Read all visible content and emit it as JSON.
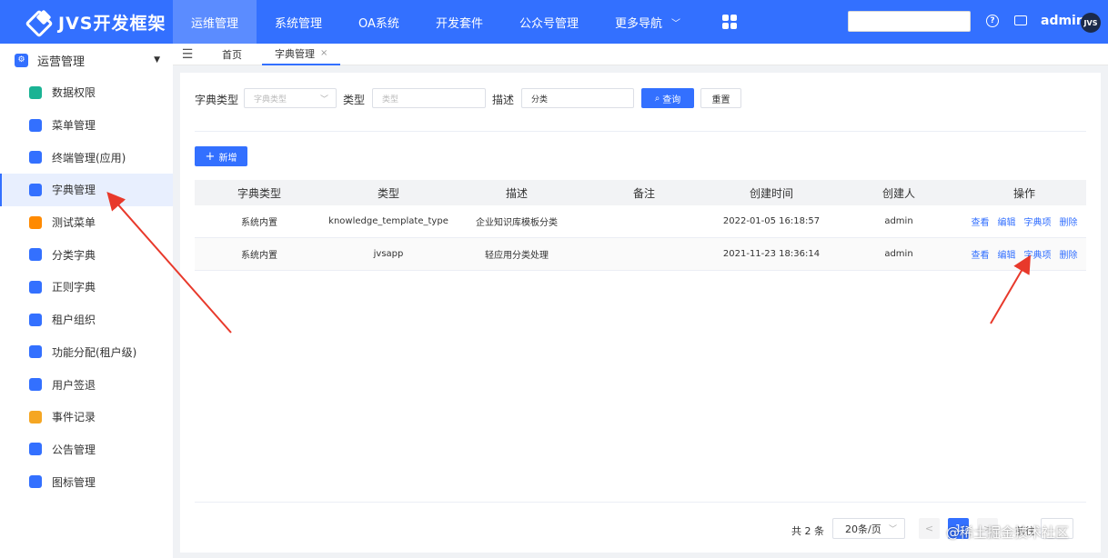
{
  "app": {
    "logo_text": "JVS开发框架"
  },
  "topnav": {
    "items": [
      {
        "label": "运维管理",
        "active": true
      },
      {
        "label": "系统管理",
        "active": false
      },
      {
        "label": "OA系统",
        "active": false
      },
      {
        "label": "开发套件",
        "active": false
      },
      {
        "label": "公众号管理",
        "active": false
      },
      {
        "label": "更多导航",
        "active": false
      }
    ],
    "user_name": "admin",
    "avatar_text": "JVS"
  },
  "sidebar": {
    "group_label": "运营管理",
    "items": [
      {
        "label": "数据权限",
        "icon": "data-permission-icon",
        "color": "#1ab394"
      },
      {
        "label": "菜单管理",
        "icon": "menu-icon",
        "color": "#3370ff"
      },
      {
        "label": "终端管理(应用)",
        "icon": "terminal-icon",
        "color": "#3370ff"
      },
      {
        "label": "字典管理",
        "icon": "dictionary-icon",
        "color": "#3370ff",
        "active": true
      },
      {
        "label": "测试菜单",
        "icon": "home-icon",
        "color": "#ff8a00"
      },
      {
        "label": "分类字典",
        "icon": "chart-icon",
        "color": "#3370ff"
      },
      {
        "label": "正则字典",
        "icon": "regex-icon",
        "color": "#3370ff"
      },
      {
        "label": "租户组织",
        "icon": "tenant-icon",
        "color": "#3370ff"
      },
      {
        "label": "功能分配(租户级)",
        "icon": "function-icon",
        "color": "#3370ff"
      },
      {
        "label": "用户签退",
        "icon": "logout-icon",
        "color": "#3370ff"
      },
      {
        "label": "事件记录",
        "icon": "event-icon",
        "color": "#f5a623"
      },
      {
        "label": "公告管理",
        "icon": "notice-icon",
        "color": "#3370ff"
      },
      {
        "label": "图标管理",
        "icon": "icon-manage-icon",
        "color": "#3370ff"
      }
    ]
  },
  "tabs": [
    {
      "label": "首页",
      "active": false
    },
    {
      "label": "字典管理",
      "active": true,
      "close": "×"
    }
  ],
  "filters": {
    "dict_type_label": "字典类型",
    "dict_type_placeholder": "字典类型",
    "type_label": "类型",
    "type_placeholder": "类型",
    "desc_label": "描述",
    "desc_value": "分类",
    "search_button": "查询",
    "reset_button": "重置"
  },
  "add_button": "新增",
  "table": {
    "columns": [
      "字典类型",
      "类型",
      "描述",
      "备注",
      "创建时间",
      "创建人",
      "操作"
    ],
    "rows": [
      {
        "dict_type": "系统内置",
        "type": "knowledge_template_type",
        "desc": "企业知识库模板分类",
        "remark": "",
        "created_at": "2022-01-05 16:18:57",
        "creator": "admin"
      },
      {
        "dict_type": "系统内置",
        "type": "jvsapp",
        "desc": "轻应用分类处理",
        "remark": "",
        "created_at": "2021-11-23 18:36:14",
        "creator": "admin"
      }
    ],
    "actions": [
      "查看",
      "编辑",
      "字典项",
      "删除"
    ]
  },
  "pagination": {
    "total_text": "共 2 条",
    "page_size": "20条/页",
    "current_page": "1",
    "prev": "<",
    "next": ">",
    "goto_label": "前往"
  },
  "watermark": "@稀土掘金技术社区",
  "colors": {
    "primary": "#3370ff",
    "annotation_arrow": "#e8392b"
  }
}
